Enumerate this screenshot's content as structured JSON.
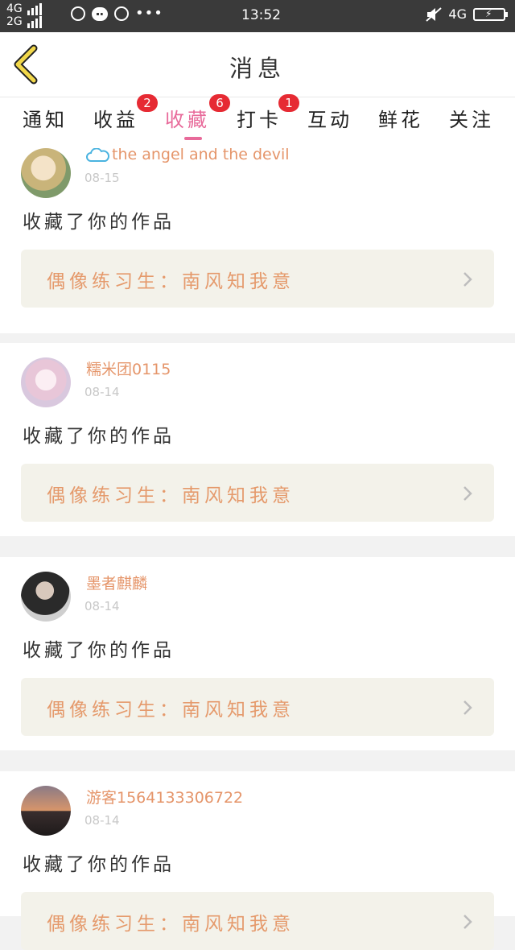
{
  "status_bar": {
    "net_top": "4G",
    "net_bottom": "2G",
    "time": "13:52",
    "right_net": "4G"
  },
  "header": {
    "title": "消息"
  },
  "tabs": [
    {
      "label": "通知",
      "badge": ""
    },
    {
      "label": "收益",
      "badge": "2"
    },
    {
      "label": "收藏",
      "badge": "6"
    },
    {
      "label": "打卡",
      "badge": "1"
    },
    {
      "label": "互动",
      "badge": ""
    },
    {
      "label": "鲜花",
      "badge": ""
    },
    {
      "label": "关注",
      "badge": ""
    }
  ],
  "active_tab": "收藏",
  "notifications": [
    {
      "username": "the angel and the devil",
      "date": "08-15",
      "action": "收藏了你的作品",
      "work_title": "偶像练习生：南风知我意"
    },
    {
      "username": "糯米团0115",
      "date": "08-14",
      "action": "收藏了你的作品",
      "work_title": "偶像练习生：南风知我意"
    },
    {
      "username": "墨者麒麟",
      "date": "08-14",
      "action": "收藏了你的作品",
      "work_title": "偶像练习生：南风知我意"
    },
    {
      "username": "游客1564133306722",
      "date": "08-14",
      "action": "收藏了你的作品",
      "work_title": "偶像练习生：南风知我意"
    }
  ],
  "colors": {
    "accent": "#e86a9a",
    "username": "#e5956a",
    "badge": "#e62a33",
    "back_arrow": "#f2d84a"
  }
}
